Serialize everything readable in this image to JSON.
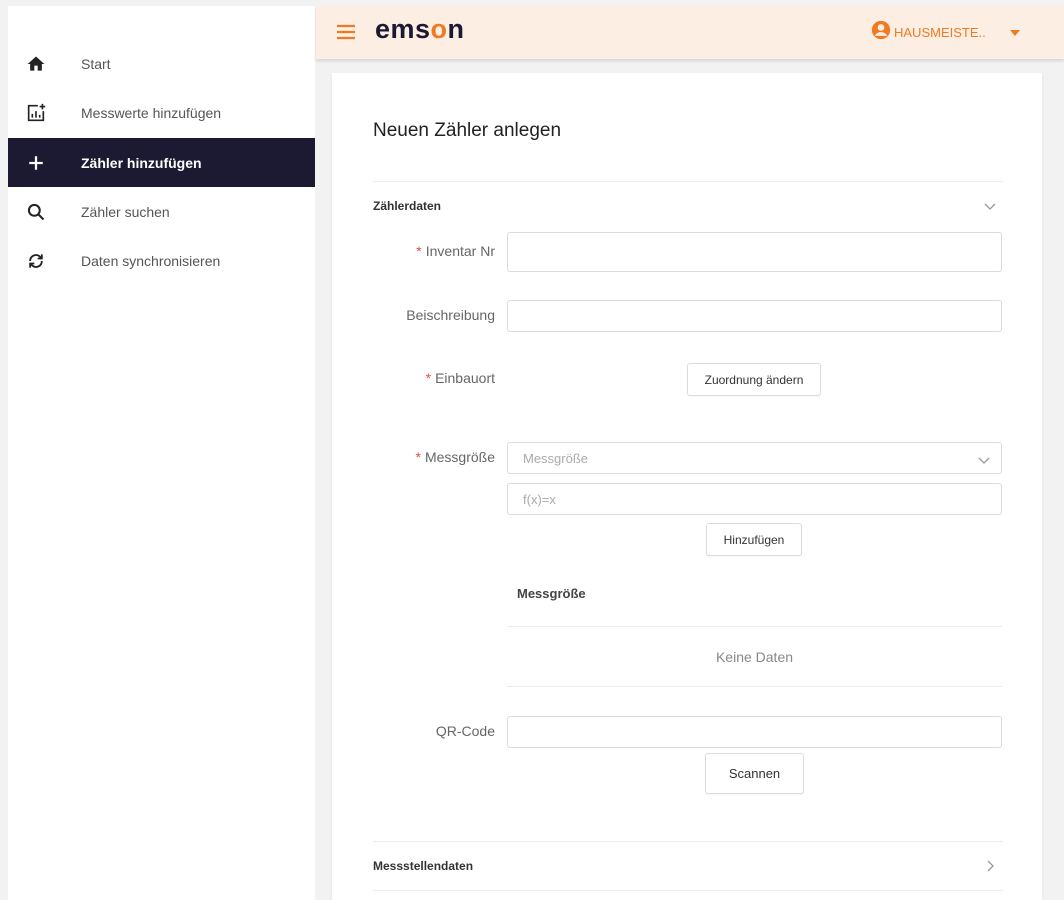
{
  "sidebar": {
    "items": [
      {
        "label": "Start",
        "icon": "home-icon"
      },
      {
        "label": "Messwerte hinzufügen",
        "icon": "chart-add-icon"
      },
      {
        "label": "Zähler hinzufügen",
        "icon": "plus-icon"
      },
      {
        "label": "Zähler suchen",
        "icon": "search-icon"
      },
      {
        "label": "Daten synchronisieren",
        "icon": "sync-icon"
      }
    ],
    "active_index": 2
  },
  "header": {
    "logo_prefix": "ems",
    "logo_o": "o",
    "logo_suffix": "n",
    "user_name": "HAUSMEISTE..",
    "accent_color": "#f07a22",
    "header_bg": "#fdeee4"
  },
  "form": {
    "title": "Neuen Zähler anlegen",
    "section1_title": "Zählerdaten",
    "inventar_label": "Inventar Nr",
    "inventar_value": "",
    "beschreibung_label": "Beischreibung",
    "beschreibung_value": "",
    "einbauort_label": "Einbauort",
    "zuordnung_button": "Zuordnung ändern",
    "messgroesse_label": "Messgröße",
    "messgroesse_placeholder": "Messgröße",
    "formula_placeholder": "f(x)=x",
    "hinzufuegen_button": "Hinzufügen",
    "table_header": "Messgröße",
    "table_empty": "Keine Daten",
    "qr_label": "QR-Code",
    "qr_value": "",
    "scan_button": "Scannen",
    "section2_title": "Messstellendaten",
    "required_mark": "*"
  }
}
